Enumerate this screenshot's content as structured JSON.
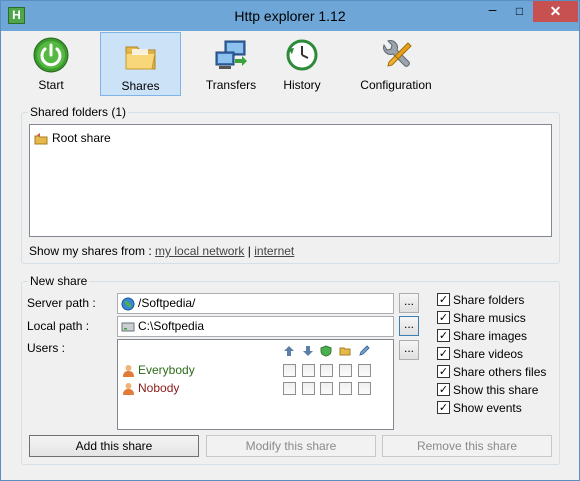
{
  "window": {
    "title": "Http explorer 1.12",
    "app_icon": "H",
    "minimize": "–",
    "maximize": "□",
    "close": "✕"
  },
  "toolbar": {
    "start": "Start",
    "shares": "Shares",
    "transfers": "Transfers",
    "history": "History",
    "configuration": "Configuration"
  },
  "shared_folders": {
    "legend": "Shared folders (1)",
    "items": [
      "Root share"
    ],
    "show_from_label": "Show my shares from :",
    "link_local": "my local network",
    "separator": "|",
    "link_internet": "internet"
  },
  "new_share": {
    "legend": "New share",
    "server_path_label": "Server path :",
    "server_path_value": "/Softpedia/",
    "local_path_label": "Local path :",
    "local_path_value": "C:\\Softpedia",
    "users_label": "Users :",
    "ellipsis": "...",
    "users": [
      {
        "name": "Everybody",
        "color": "#2e6b1a"
      },
      {
        "name": "Nobody",
        "color": "#8b1a1a"
      }
    ],
    "options": [
      "Share folders",
      "Share musics",
      "Share images",
      "Share videos",
      "Share others files",
      "Show this share",
      "Show events"
    ],
    "check_mark": "✓"
  },
  "buttons": {
    "add": "Add this share",
    "modify": "Modify this share",
    "remove": "Remove this share"
  }
}
